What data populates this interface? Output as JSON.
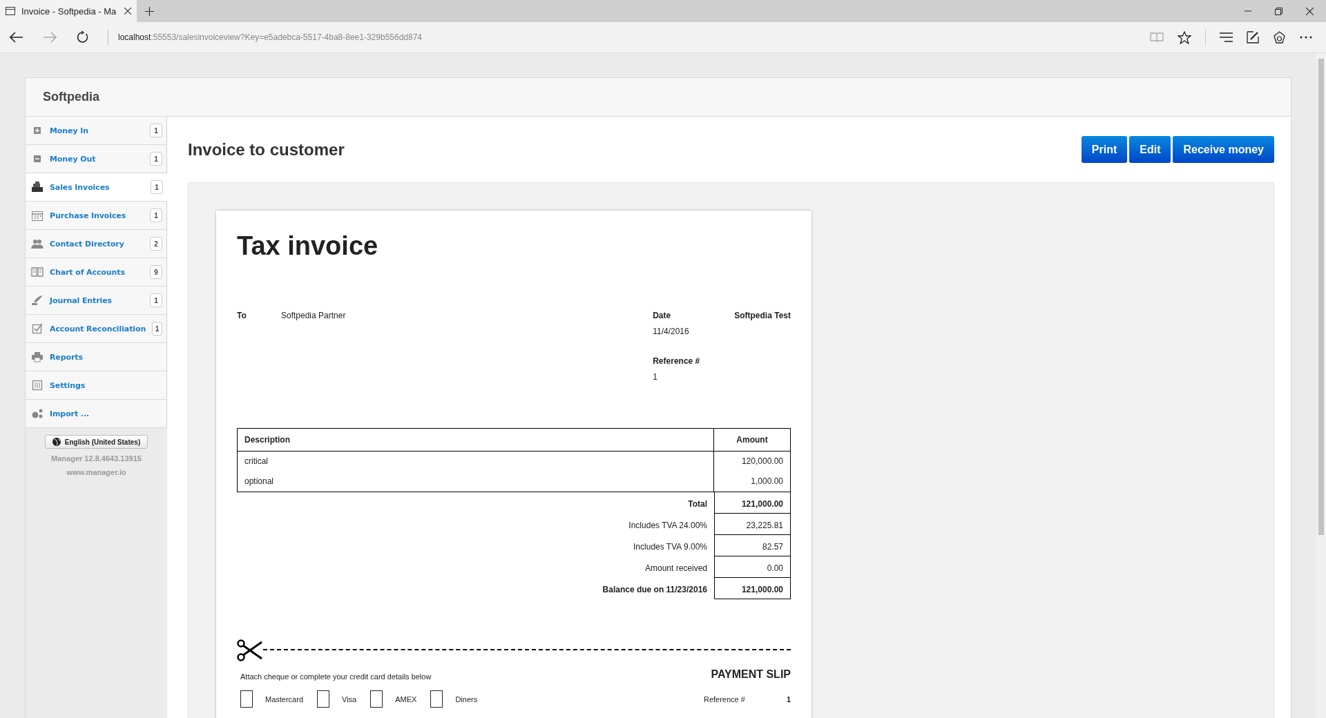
{
  "browser": {
    "tab_title": "Invoice - Softpedia - Ma",
    "address_host": "localhost",
    "address_path": ":55553/salesinvoiceview?Key=e5adebca-5517-4ba8-8ee1-329b556dd874"
  },
  "business_name": "Softpedia",
  "sidebar": {
    "items": [
      {
        "label": "Money In",
        "count": "1",
        "selected": false
      },
      {
        "label": "Money Out",
        "count": "1",
        "selected": false
      },
      {
        "label": "Sales Invoices",
        "count": "1",
        "selected": true
      },
      {
        "label": "Purchase Invoices",
        "count": "1",
        "selected": false
      },
      {
        "label": "Contact Directory",
        "count": "2",
        "selected": false
      },
      {
        "label": "Chart of Accounts",
        "count": "9",
        "selected": false
      },
      {
        "label": "Journal Entries",
        "count": "1",
        "selected": false
      },
      {
        "label": "Account Reconciliation",
        "count": "1",
        "selected": false
      },
      {
        "label": "Reports",
        "selected": false
      },
      {
        "label": "Settings",
        "selected": false
      },
      {
        "label": "Import ...",
        "selected": false
      }
    ],
    "language_button": "English (United States)",
    "version": "Manager 12.8.4643.13915",
    "website": "www.manager.io"
  },
  "page_title": "Invoice to customer",
  "actions": [
    "Print",
    "Edit",
    "Receive money"
  ],
  "invoice": {
    "title": "Tax invoice",
    "to_label": "To",
    "to_value": "Softpedia Partner",
    "date_label": "Date",
    "date_value": "11/4/2016",
    "issuer": "Softpedia Test",
    "reference_label": "Reference #",
    "reference_value": "1",
    "columns": [
      "Description",
      "Amount"
    ],
    "lines": [
      {
        "description": "critical",
        "amount": "120,000.00"
      },
      {
        "description": "optional",
        "amount": "1,000.00"
      }
    ],
    "totals": [
      {
        "label": "Total",
        "amount": "121,000.00",
        "bold": true
      },
      {
        "label": "Includes TVA 24.00%",
        "amount": "23,225.81",
        "bold": false
      },
      {
        "label": "Includes TVA 9.00%",
        "amount": "82.57",
        "bold": false
      },
      {
        "label": "Amount received",
        "amount": "0.00",
        "bold": false
      },
      {
        "label": "Balance due on 11/23/2016",
        "amount": "121,000.00",
        "bold": true
      }
    ],
    "slip": {
      "instructions": "Attach cheque or complete your credit card details below",
      "title": "PAYMENT SLIP",
      "cards": [
        {
          "label": "Mastercard",
          "checked": false
        },
        {
          "label": "Visa",
          "checked": false
        },
        {
          "label": "AMEX",
          "checked": false
        },
        {
          "label": "Diners",
          "checked": false
        }
      ],
      "reference_label": "Reference #",
      "reference_value": "1"
    }
  }
}
